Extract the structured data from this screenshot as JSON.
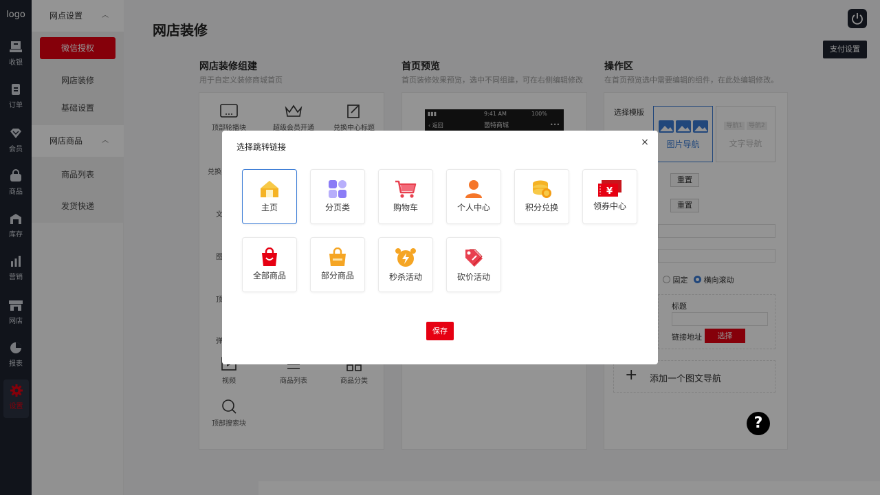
{
  "rail": {
    "logo": "logo",
    "items": [
      {
        "label": "收银",
        "icon": "cashier-icon"
      },
      {
        "label": "订单",
        "icon": "order-icon"
      },
      {
        "label": "会员",
        "icon": "member-icon"
      },
      {
        "label": "商品",
        "icon": "goods-icon"
      },
      {
        "label": "库存",
        "icon": "stock-icon"
      },
      {
        "label": "营销",
        "icon": "marketing-icon"
      },
      {
        "label": "网店",
        "icon": "store-icon"
      },
      {
        "label": "报表",
        "icon": "report-icon"
      },
      {
        "label": "设置",
        "icon": "settings-icon"
      }
    ]
  },
  "submenu": {
    "group1": {
      "title": "网点设置",
      "items": [
        "微信授权",
        "网店装修",
        "基础设置"
      ]
    },
    "group2": {
      "title": "网店商品",
      "items": [
        "商品列表",
        "发货快递"
      ]
    }
  },
  "header": {
    "title": "网店装修",
    "pay_settings": "支付设置"
  },
  "builder": {
    "title": "网店装修组建",
    "desc": "用于自定义装修商城首页",
    "components": [
      "顶部轮播块",
      "超级会员开通",
      "兑换中心标题",
      "兑换",
      "文",
      "图",
      "顶",
      "弹",
      "视频",
      "商品列表",
      "商品分类",
      "顶部搜索块"
    ]
  },
  "preview": {
    "title": "首页预览",
    "desc": "首页装修效果预览，选中不同组建，可在右侧编辑修改",
    "phone_time": "9:41 AM",
    "phone_battery": "100%",
    "phone_back": "返回",
    "phone_title": "茵特商城",
    "phone_more": "•••"
  },
  "ops": {
    "title": "操作区",
    "desc": "在首页预览选中需要编辑的组件，在此处编辑修改。",
    "select_template": "选择模版",
    "tpl_image_nav": "图片导航",
    "tpl_text_nav": "文字导航",
    "nav1": "导航1",
    "nav2": "导航2",
    "reset": "重置",
    "fixed": "固定",
    "horizontal_scroll": "横向滚动",
    "title_label": "标题",
    "link_label": "链接地址",
    "select_btn": "选择",
    "add_nav": "添加一个图文导航"
  },
  "modal": {
    "title": "选择跳转链接",
    "close": "×",
    "save": "保存",
    "options": [
      {
        "label": "主页",
        "icon": "home-icon"
      },
      {
        "label": "分页类",
        "icon": "category-grid-icon"
      },
      {
        "label": "购物车",
        "icon": "cart-icon"
      },
      {
        "label": "个人中心",
        "icon": "user-icon"
      },
      {
        "label": "积分兑换",
        "icon": "coins-icon"
      },
      {
        "label": "领券中心",
        "icon": "coupon-icon"
      },
      {
        "label": "全部商品",
        "icon": "bag-icon"
      },
      {
        "label": "部分商品",
        "icon": "bag-partial-icon"
      },
      {
        "label": "秒杀活动",
        "icon": "flash-alarm-icon"
      },
      {
        "label": "砍价活动",
        "icon": "price-tag-icon"
      }
    ]
  },
  "help": "?",
  "colors": {
    "accent": "#e60012",
    "dark": "#1e2430",
    "selected": "#3a7bd5"
  }
}
